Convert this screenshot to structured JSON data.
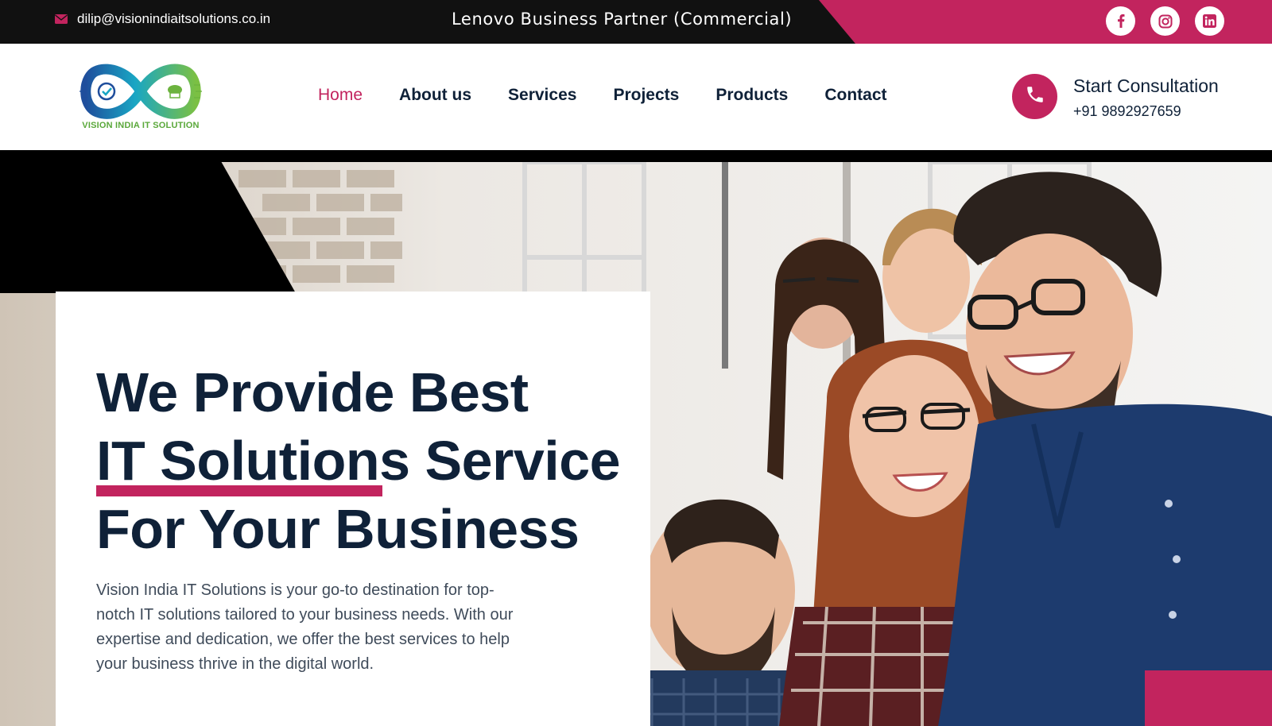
{
  "topbar": {
    "email": "dilip@visionindiaitsolutions.co.in",
    "partner_text": "Lenovo Business Partner (Commercial)",
    "social": [
      {
        "icon": "facebook-icon"
      },
      {
        "icon": "instagram-icon"
      },
      {
        "icon": "linkedin-icon"
      }
    ]
  },
  "header": {
    "logo_text": "VISION INDIA IT SOLUTION",
    "nav": [
      {
        "label": "Home",
        "active": true
      },
      {
        "label": "About us"
      },
      {
        "label": "Services"
      },
      {
        "label": "Projects"
      },
      {
        "label": "Products"
      },
      {
        "label": "Contact"
      }
    ],
    "consultation": {
      "icon": "phone-icon",
      "title": "Start Consultation",
      "phone": "+91 9892927659"
    }
  },
  "hero": {
    "headline_line1": "We Provide Best",
    "headline_highlight": "IT Solutions",
    "headline_line2_rest": " Service",
    "headline_line3": "For Your Business",
    "description": "Vision India IT Solutions is your go-to destination for top-notch IT solutions tailored to your business needs. With our expertise and dedication, we offer the best services to help your business thrive in the digital world."
  },
  "colors": {
    "accent": "#c2245e",
    "dark_text": "#0f2138",
    "topbar_bg": "#111111"
  }
}
